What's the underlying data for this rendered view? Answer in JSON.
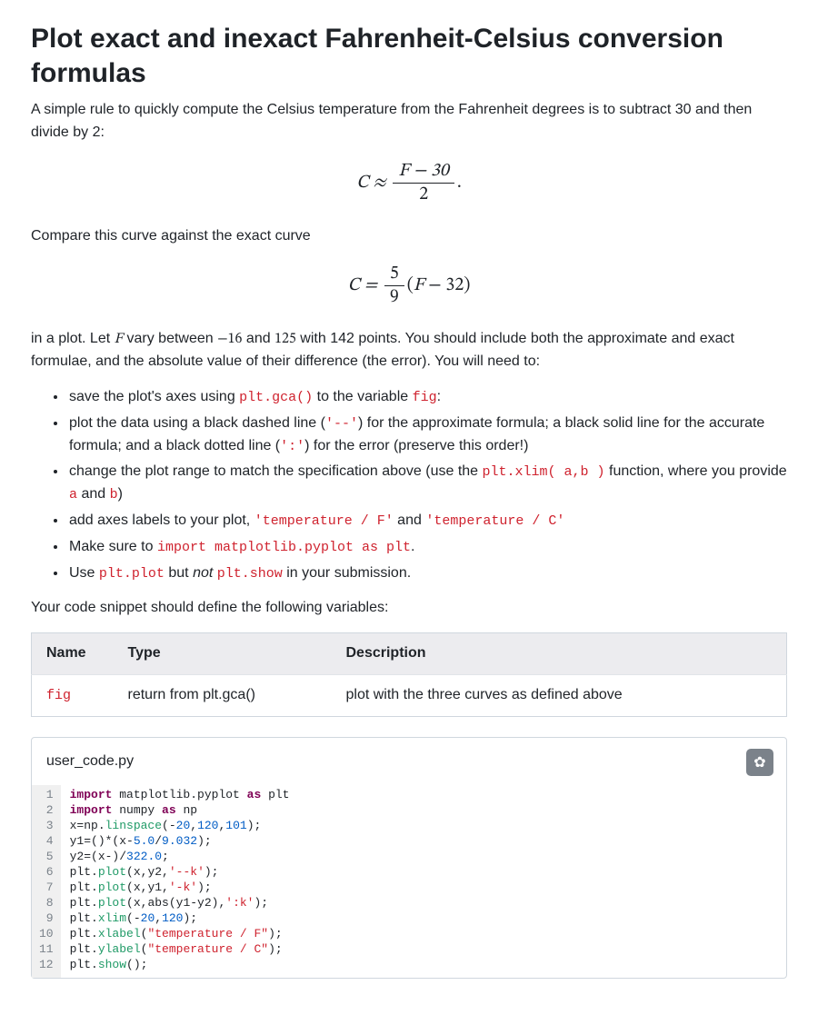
{
  "title": "Plot exact and inexact Fahrenheit-Celsius conversion formulas",
  "intro": "A simple rule to quickly compute the Celsius temperature from the Fahrenheit degrees is to subtract 30 and then divide by 2:",
  "eq1": {
    "lhs": "C ≈",
    "num": "F − 30",
    "den": "2",
    "tail": "."
  },
  "compare": "Compare this curve against the exact curve",
  "eq2": {
    "lhs": "C =",
    "num": "5",
    "den": "9",
    "tail": "(F − 32)"
  },
  "range": {
    "pre": "in a plot. Let ",
    "F": "F",
    "between": " vary between ",
    "lo": "−16",
    "and": " and ",
    "hi": "125",
    "post1": " with 142 points. You should include both the approximate and exact formulae, and the absolute value of their difference (the error). You will need to:"
  },
  "bullets": {
    "b1a": "save the plot's axes using ",
    "b1code1": "plt.gca()",
    "b1b": " to the variable ",
    "b1code2": "fig",
    "b1c": ":",
    "b2a": "plot the data using a black dashed line (",
    "b2code1": "'--'",
    "b2b": ") for the approximate formula; a black solid line for the accurate formula; and a black dotted line (",
    "b2code2": "':'",
    "b2c": ") for the error (preserve this order!)",
    "b3a": "change the plot range to match the specification above (use the ",
    "b3code1": "plt.xlim( a,b )",
    "b3b": " function, where you provide ",
    "b3code2": "a",
    "b3c": " and ",
    "b3code3": "b",
    "b3d": ")",
    "b4a": "add axes labels to your plot, ",
    "b4code1": "'temperature / F'",
    "b4b": " and ",
    "b4code2": "'temperature / C'",
    "b5a": "Make sure to ",
    "b5code1": "import matplotlib.pyplot as plt",
    "b5b": ".",
    "b6a": "Use ",
    "b6code1": "plt.plot",
    "b6b": " but ",
    "b6not": "not",
    "b6c": " ",
    "b6code2": "plt.show",
    "b6d": " in your submission."
  },
  "varPrompt": "Your code snippet should define the following variables:",
  "table": {
    "h1": "Name",
    "h2": "Type",
    "h3": "Description",
    "r1c1": "fig",
    "r1c2": "return from plt.gca()",
    "r1c3": "plot with the three curves as defined above"
  },
  "filePanel": {
    "filename": "user_code.py",
    "gear": "✿"
  },
  "code": {
    "lineNumbers": "1\n2\n3\n4\n5\n6\n7\n8\n9\n10\n11\n12",
    "lines": [
      {
        "kw": "import",
        "a": " matplotlib.pyplot ",
        "kw2": "as",
        "b": " plt"
      },
      {
        "kw": "import",
        "a": " numpy ",
        "kw2": "as",
        "b": " np"
      },
      {
        "plain": "x=np.",
        "attr": "linspace",
        "rest": "(-",
        "n1": "20",
        "c1": ",",
        "n2": "120",
        "c2": ",",
        "n3": "101",
        "tail": ");"
      },
      {
        "plain": "y1=(",
        "n1": "5.0",
        "c1": "/",
        "n2": "9.0",
        "rest": ")*(x-",
        "n3": "32",
        "tail": ");"
      },
      {
        "plain": "y2=(x-",
        "n1": "32",
        "rest": ")/",
        "n2": "2.0",
        "tail": ";"
      },
      {
        "plain": "plt.",
        "attr": "plot",
        "rest": "(x,y2,",
        "s": "'--k'",
        "tail": ");"
      },
      {
        "plain": "plt.",
        "attr": "plot",
        "rest": "(x,y1,",
        "s": "'-k'",
        "tail": ");"
      },
      {
        "plain": "plt.",
        "attr": "plot",
        "rest": "(x,abs(y1-y2),",
        "s": "':k'",
        "tail": ");"
      },
      {
        "plain": "plt.",
        "attr": "xlim",
        "rest": "(-",
        "n1": "20",
        "c1": ",",
        "n2": "120",
        "tail": ");"
      },
      {
        "plain": "plt.",
        "attr": "xlabel",
        "rest": "(",
        "s": "\"temperature / F\"",
        "tail": ");"
      },
      {
        "plain": "plt.",
        "attr": "ylabel",
        "rest": "(",
        "s": "\"temperature / C\"",
        "tail": ");"
      },
      {
        "plain": "plt.",
        "attr": "show",
        "rest": "();"
      }
    ]
  }
}
